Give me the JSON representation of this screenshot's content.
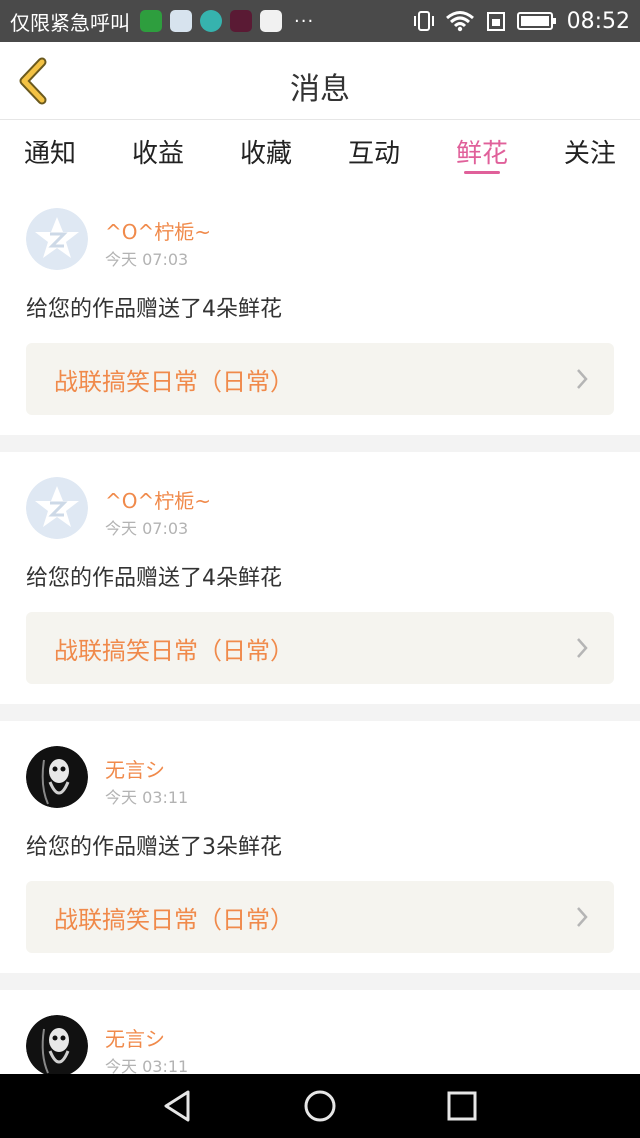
{
  "status_bar": {
    "carrier": "仅限紧急呼叫",
    "more": "···",
    "time": "08:52"
  },
  "header": {
    "title": "消息"
  },
  "tabs": [
    {
      "label": "通知"
    },
    {
      "label": "收益"
    },
    {
      "label": "收藏"
    },
    {
      "label": "互动"
    },
    {
      "label": "鲜花",
      "active": true
    },
    {
      "label": "关注"
    }
  ],
  "feed": [
    {
      "username": "^O^柠栀~",
      "time": "今天 07:03",
      "message": "给您的作品赠送了4朵鲜花",
      "work": "战联搞笑日常（日常）",
      "avatar": "qq-default-avatar"
    },
    {
      "username": "^O^柠栀~",
      "time": "今天 07:03",
      "message": "给您的作品赠送了4朵鲜花",
      "work": "战联搞笑日常（日常）",
      "avatar": "qq-default-avatar"
    },
    {
      "username": "无言シ",
      "time": "今天 03:11",
      "message": "给您的作品赠送了3朵鲜花",
      "work": "战联搞笑日常（日常）",
      "avatar": "skull-avatar"
    },
    {
      "username": "无言シ",
      "time": "今天 03:11",
      "avatar": "skull-avatar"
    }
  ],
  "colors": {
    "accent_pink": "#e0609a",
    "accent_orange": "#f08a4b",
    "back_yellow": "#f3c244"
  }
}
